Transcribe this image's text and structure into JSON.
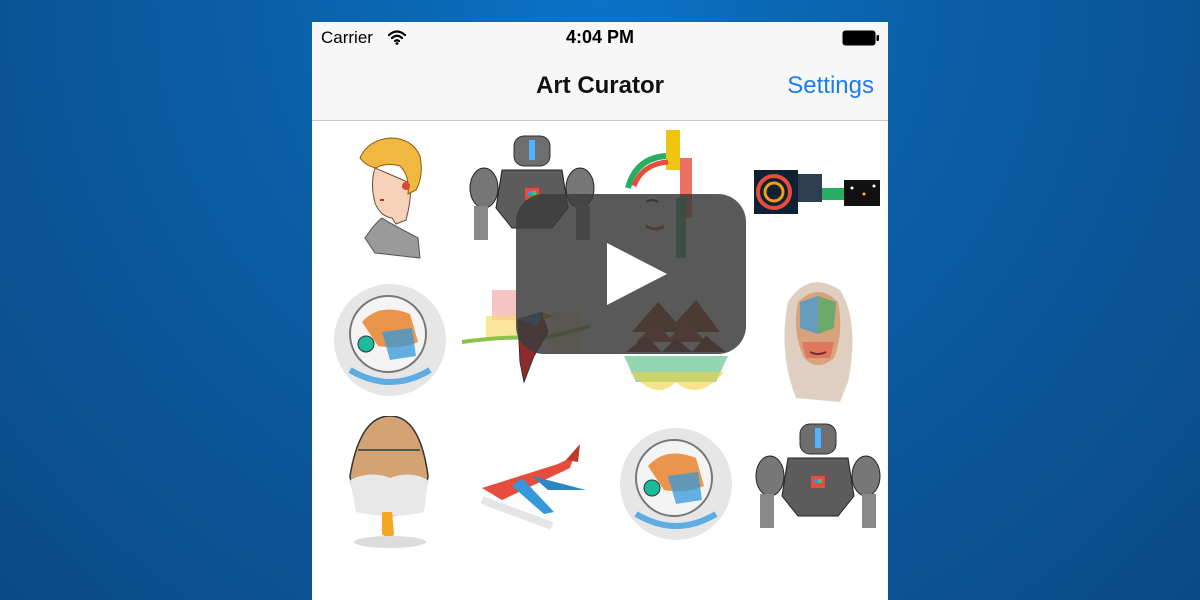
{
  "status_bar": {
    "carrier": "Carrier",
    "time": "4:04 PM"
  },
  "nav_bar": {
    "title": "Art Curator",
    "settings_label": "Settings"
  },
  "colors": {
    "accent": "#1a7cf2",
    "background": "#0b5fa6",
    "nav_background": "#f7f7f7"
  },
  "gallery": {
    "items": [
      {
        "icon": "blonde-girl-portrait-icon"
      },
      {
        "icon": "robot-icon"
      },
      {
        "icon": "abstract-face-icon"
      },
      {
        "icon": "abstract-strip-icon"
      },
      {
        "icon": "astronaut-icon"
      },
      {
        "icon": "bird-icon"
      },
      {
        "icon": "mountain-landscape-icon"
      },
      {
        "icon": "woman-portrait-icon"
      },
      {
        "icon": "egg-icon"
      },
      {
        "icon": "airplane-icon"
      },
      {
        "icon": "astronaut-icon"
      },
      {
        "icon": "robot-icon"
      }
    ]
  },
  "video_overlay": {
    "icon": "play-icon"
  }
}
